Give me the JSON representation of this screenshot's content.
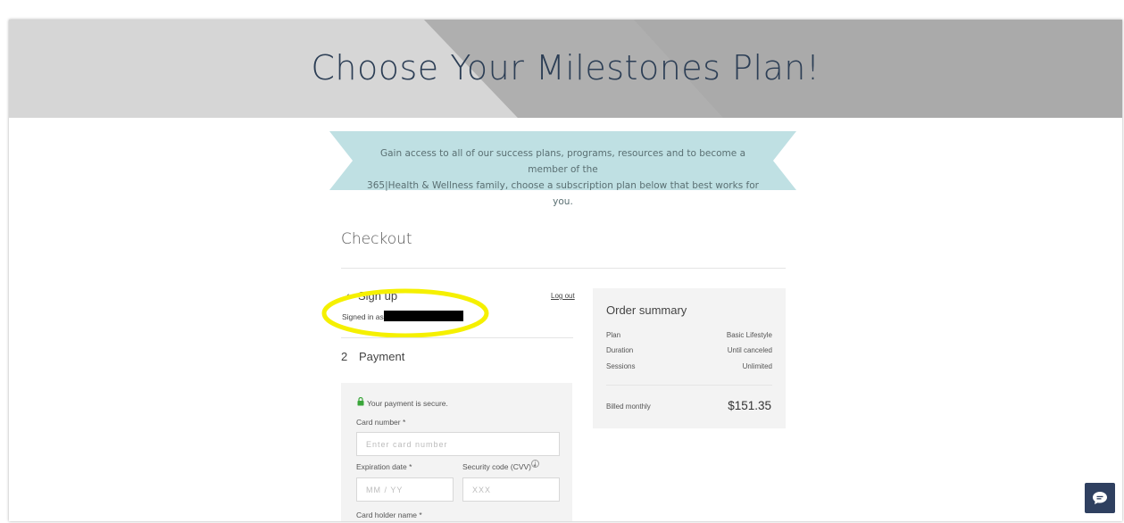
{
  "hero": {
    "title": "Choose Your Milestones Plan!"
  },
  "banner": {
    "line1": "Gain access to all of our success plans, programs, resources and to become a member of the",
    "line2": "365|Health & Wellness family, choose a subscription plan below that best works for you."
  },
  "checkout": {
    "title": "Checkout",
    "step1": {
      "check": "✓",
      "label": "Sign up",
      "logout": "Log out",
      "signed_in": "Signed in as"
    },
    "step2": {
      "number": "2",
      "label": "Payment"
    },
    "payment": {
      "secure": "Your payment is secure.",
      "card_number_label": "Card number *",
      "card_number_placeholder": "Enter card number",
      "expiration_label": "Expiration date *",
      "expiration_placeholder": "MM / YY",
      "security_label": "Security code (CVV) *",
      "security_placeholder": "XXX",
      "info_icon": "i",
      "holder_label": "Card holder name *"
    }
  },
  "summary": {
    "title": "Order summary",
    "rows": [
      {
        "label": "Plan",
        "value": "Basic Lifestyle"
      },
      {
        "label": "Duration",
        "value": "Until canceled"
      },
      {
        "label": "Sessions",
        "value": "Unlimited"
      }
    ],
    "billed_label": "Billed monthly",
    "billed_price": "$151.35"
  },
  "colors": {
    "title": "#2c3e55",
    "ribbon": "#bfe0e3",
    "highlight": "#f5f000",
    "chat": "#2f4060"
  },
  "icons": {
    "check": "check-icon",
    "lock": "lock-icon",
    "info": "info-icon",
    "chat": "chat-icon"
  }
}
